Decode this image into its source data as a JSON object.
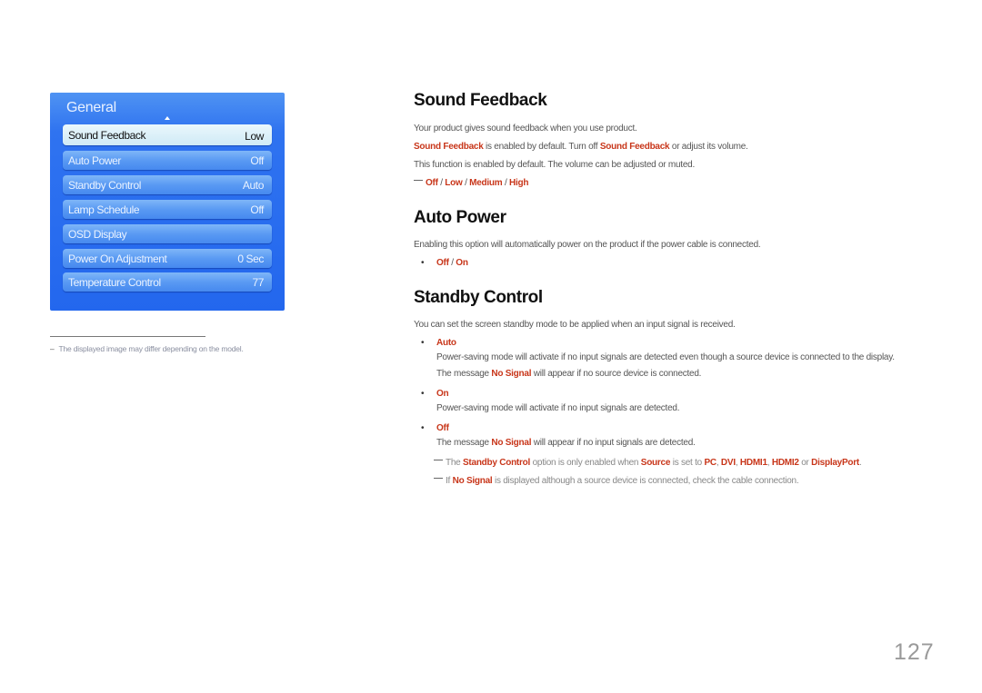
{
  "osd_menu": {
    "title": "General",
    "items": [
      {
        "label": "Sound Feedback",
        "value": "Low",
        "selected": true
      },
      {
        "label": "Auto Power",
        "value": "Off"
      },
      {
        "label": "Standby Control",
        "value": "Auto"
      },
      {
        "label": "Lamp Schedule",
        "value": "Off"
      },
      {
        "label": "OSD Display",
        "value": ""
      },
      {
        "label": "Power On Adjustment",
        "value": "0 Sec"
      },
      {
        "label": "Temperature Control",
        "value": "77"
      }
    ]
  },
  "footnote": {
    "dash": "–",
    "text": "The displayed image may differ depending on the model."
  },
  "sound_feedback": {
    "heading": "Sound Feedback",
    "line1": "Your product gives sound feedback when you use product.",
    "line2": {
      "term1": "Sound Feedback",
      "mid": " is enabled by default. Turn off ",
      "term2": "Sound Feedback",
      "end": " or adjust its volume."
    },
    "line3": "This function is enabled by default. The volume can be adjusted or muted.",
    "options": [
      "Off",
      "Low",
      "Medium",
      "High"
    ],
    "separator": " / "
  },
  "auto_power": {
    "heading": "Auto Power",
    "line1": "Enabling this option will automatically power on the product if the power cable is connected.",
    "options": [
      "Off",
      "On"
    ],
    "bullet": "•"
  },
  "standby_control": {
    "heading": "Standby Control",
    "line1": "You can set the screen standby mode to be applied when an input signal is received.",
    "bullet": "•",
    "auto": {
      "label": "Auto",
      "desc1": "Power-saving mode will activate if no input signals are detected even though a source device is connected to the display.",
      "desc2_pre": "The message ",
      "desc2_term": "No Signal",
      "desc2_post": " will appear if no source device is connected."
    },
    "on": {
      "label": "On",
      "desc": "Power-saving mode will activate if no input signals are detected."
    },
    "off": {
      "label": "Off",
      "desc_pre": "The message ",
      "desc_term": "No Signal",
      "desc_post": " will appear if no input signals are detected."
    },
    "note1": {
      "pre": "The ",
      "term1": "Standby Control",
      "mid1": " option is only enabled when ",
      "term2": "Source",
      "mid2": " is set to ",
      "src1": "PC",
      "c1": ", ",
      "src2": "DVI",
      "c2": ", ",
      "src3": "HDMI1",
      "c3": ", ",
      "src4": "HDMI2",
      "or": " or ",
      "src5": "DisplayPort",
      "end": "."
    },
    "note2": {
      "pre": "If ",
      "term": "No Signal",
      "post": " is displayed although a source device is connected, check the cable connection."
    }
  },
  "page_number": "127"
}
